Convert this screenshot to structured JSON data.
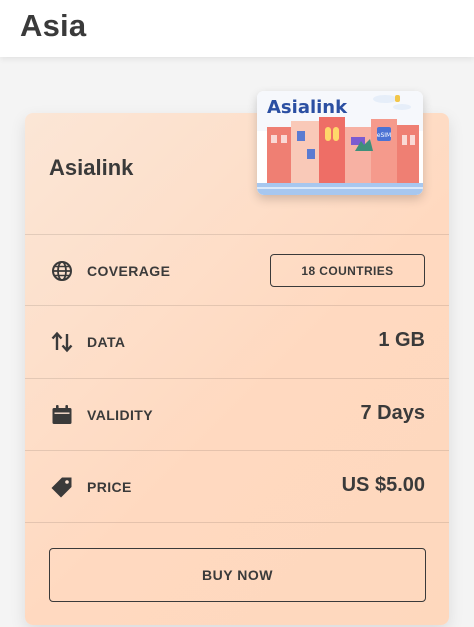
{
  "header": {
    "title": "Asia"
  },
  "card": {
    "operator_name": "Asialink",
    "sim_card": {
      "brand": "Asialink",
      "badge": "eSIM"
    },
    "rows": [
      {
        "icon": "globe-icon",
        "label": "COVERAGE",
        "button_label": "18 COUNTRIES"
      },
      {
        "icon": "up-down-arrows-icon",
        "label": "DATA",
        "value": "1 GB"
      },
      {
        "icon": "calendar-icon",
        "label": "VALIDITY",
        "value": "7 Days"
      },
      {
        "icon": "price-tag-icon",
        "label": "PRICE",
        "value": "US $5.00"
      }
    ],
    "buy_label": "BUY NOW"
  },
  "colors": {
    "card_gradient_start": "#fbe6d6",
    "card_gradient_end": "#fed8bd",
    "text": "#3a3a3a",
    "sim_brand": "#2b4fa2"
  }
}
